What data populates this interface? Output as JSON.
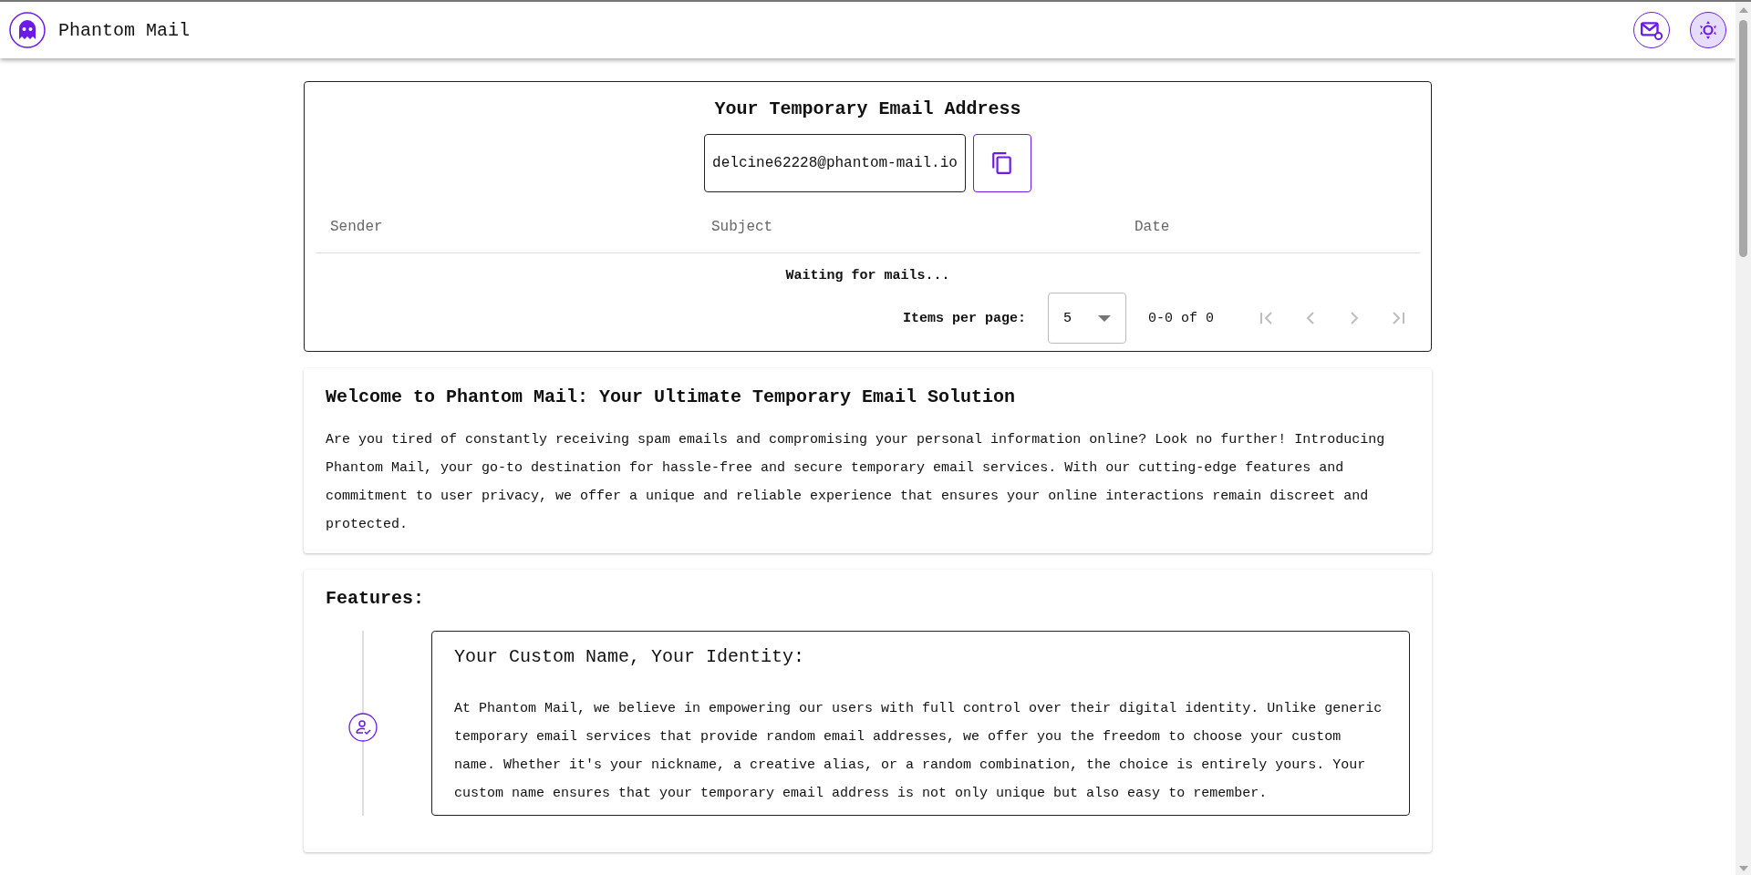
{
  "header": {
    "title": "Phantom Mail"
  },
  "email_card": {
    "title": "Your Temporary Email Address",
    "address": "delcine62228@phantom-mail.io",
    "table": {
      "columns": [
        "Sender",
        "Subject",
        "Date"
      ],
      "empty_message": "Waiting for mails..."
    },
    "pagination": {
      "items_per_page_label": "Items per page:",
      "items_per_page": "5",
      "range": "0-0 of 0"
    }
  },
  "welcome": {
    "title": "Welcome to Phantom Mail: Your Ultimate Temporary Email Solution",
    "text": "Are you tired of constantly receiving spam emails and compromising your personal information online? Look no further! Introducing Phantom Mail, your go-to destination for hassle-free and secure temporary email services. With our cutting-edge features and commitment to user privacy, we offer a unique and reliable experience that ensures your online interactions remain discreet and protected."
  },
  "features": {
    "title": "Features:",
    "items": [
      {
        "title": "Your Custom Name, Your Identity:",
        "text": "At Phantom Mail, we believe in empowering our users with full control over their digital identity. Unlike generic temporary email services that provide random email addresses, we offer you the freedom to choose your custom name. Whether it's your nickname, a creative alias, or a random combination, the choice is entirely yours. Your custom name ensures that your temporary email address is not only unique but also easy to remember."
      }
    ]
  }
}
